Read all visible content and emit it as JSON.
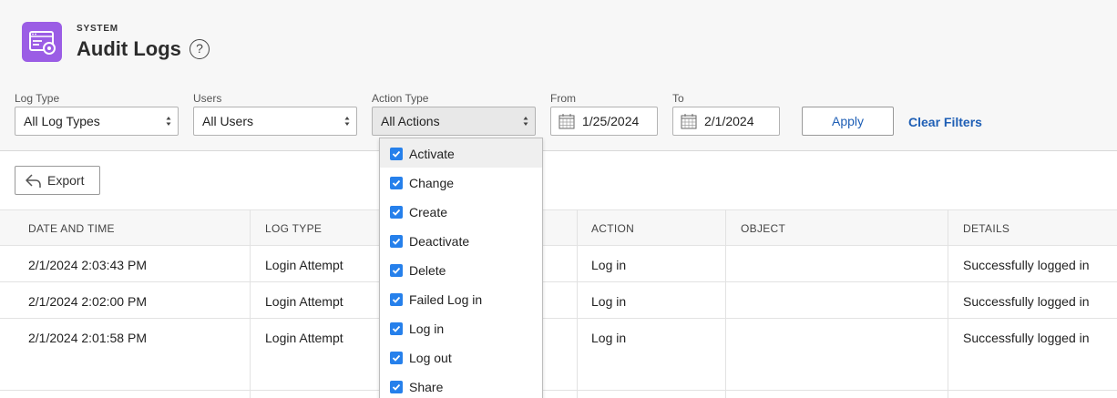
{
  "header": {
    "overline": "SYSTEM",
    "title": "Audit Logs",
    "help": "?"
  },
  "filters": {
    "log_type": {
      "label": "Log Type",
      "value": "All Log Types"
    },
    "users": {
      "label": "Users",
      "value": "All Users"
    },
    "action_type": {
      "label": "Action Type",
      "value": "All Actions"
    },
    "from": {
      "label": "From",
      "value": "1/25/2024"
    },
    "to": {
      "label": "To",
      "value": "2/1/2024"
    },
    "apply": "Apply",
    "clear": "Clear Filters"
  },
  "toolbar": {
    "export": "Export"
  },
  "table": {
    "columns": [
      "DATE AND TIME",
      "LOG TYPE",
      "",
      "ACTION",
      "OBJECT",
      "DETAILS"
    ],
    "rows": [
      {
        "datetime": "2/1/2024 2:03:43 PM",
        "log_type": "Login Attempt",
        "action": "Log in",
        "object": "",
        "details": "Successfully logged in"
      },
      {
        "datetime": "2/1/2024 2:02:00 PM",
        "log_type": "Login Attempt",
        "action": "Log in",
        "object": "",
        "details": "Successfully logged in"
      },
      {
        "datetime": "2/1/2024 2:01:58 PM",
        "log_type": "Login Attempt",
        "action": "Log in",
        "object": "",
        "details": "Successfully logged in"
      }
    ]
  },
  "action_dropdown": {
    "items": [
      {
        "label": "Activate",
        "checked": true
      },
      {
        "label": "Change",
        "checked": true
      },
      {
        "label": "Create",
        "checked": true
      },
      {
        "label": "Deactivate",
        "checked": true
      },
      {
        "label": "Delete",
        "checked": true
      },
      {
        "label": "Failed Log in",
        "checked": true
      },
      {
        "label": "Log in",
        "checked": true
      },
      {
        "label": "Log out",
        "checked": true
      },
      {
        "label": "Share",
        "checked": true
      }
    ]
  },
  "colors": {
    "app_icon": "#9b5de5",
    "link": "#1f5fb5",
    "checkbox": "#2680eb"
  }
}
